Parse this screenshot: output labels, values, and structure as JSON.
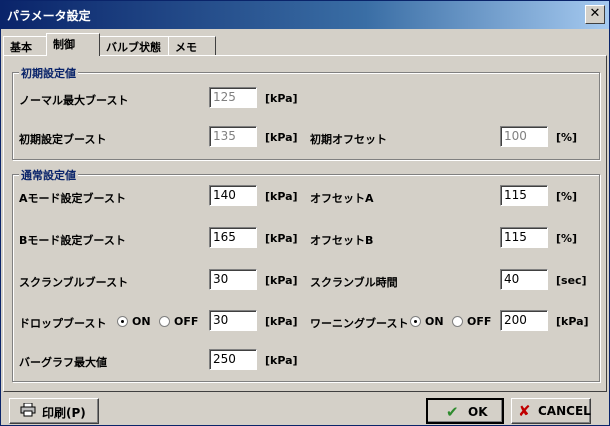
{
  "window": {
    "title": "パラメータ設定",
    "close_glyph": "✕"
  },
  "tabs": [
    {
      "label": "基本"
    },
    {
      "label": "制御"
    },
    {
      "label": "バルブ状態"
    },
    {
      "label": "メモ"
    }
  ],
  "initial_group": {
    "title": "初期設定値",
    "normal_max_boost": {
      "label": "ノーマル最大ブースト",
      "value": "125",
      "unit": "[kPa]"
    },
    "initial_boost": {
      "label": "初期設定ブースト",
      "value": "135",
      "unit": "[kPa]"
    },
    "initial_offset": {
      "label": "初期オフセット",
      "value": "100",
      "unit": "[%]"
    }
  },
  "normal_group": {
    "title": "通常設定値",
    "a_mode_boost": {
      "label": "Aモード設定ブースト",
      "value": "140",
      "unit": "[kPa]"
    },
    "offset_a": {
      "label": "オフセットA",
      "value": "115",
      "unit": "[%]"
    },
    "b_mode_boost": {
      "label": "Bモード設定ブースト",
      "value": "165",
      "unit": "[kPa]"
    },
    "offset_b": {
      "label": "オフセットB",
      "value": "115",
      "unit": "[%]"
    },
    "scramble_boost": {
      "label": "スクランブルブースト",
      "value": "30",
      "unit": "[kPa]"
    },
    "scramble_time": {
      "label": "スクランブル時間",
      "value": "40",
      "unit": "[sec]"
    },
    "drop_boost": {
      "label": "ドロップブースト",
      "on_label": "ON",
      "off_label": "OFF",
      "value": "30",
      "unit": "[kPa]"
    },
    "warning_boost": {
      "label": "ワーニングブースト",
      "on_label": "ON",
      "off_label": "OFF",
      "value": "200",
      "unit": "[kPa]"
    },
    "bargraph_max": {
      "label": "バーグラフ最大値",
      "value": "250",
      "unit": "[kPa]"
    }
  },
  "buttons": {
    "print": "印刷(P)",
    "ok": "OK",
    "cancel": "CANCEL"
  },
  "icons": {
    "print": "printer-icon",
    "ok": "check-icon",
    "cancel": "x-icon"
  },
  "colors": {
    "titlebar_start": "#0a246a",
    "group_title": "#0a246a",
    "ok_check": "#2e8b2e",
    "cancel_x": "#c00000"
  }
}
